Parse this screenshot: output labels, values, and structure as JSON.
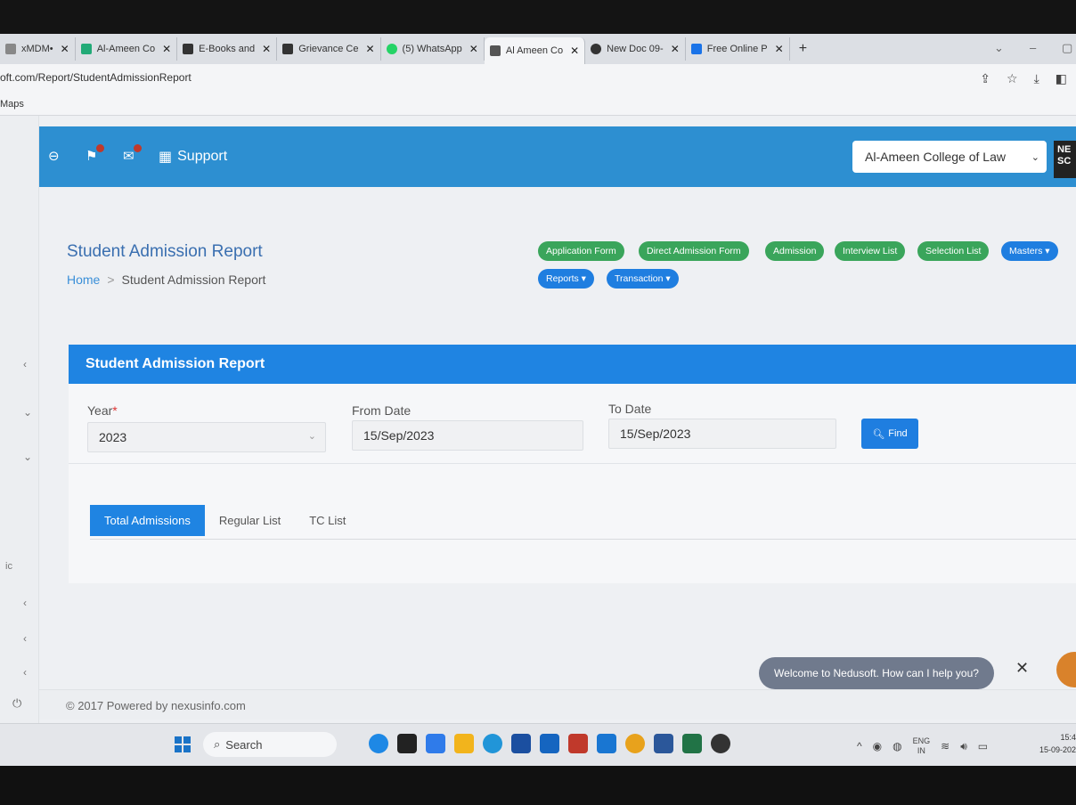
{
  "browser": {
    "tabs": [
      {
        "label": "xMDM•",
        "color": "#888"
      },
      {
        "label": "Al-Ameen Co",
        "color": "#2a7"
      },
      {
        "label": "E-Books and",
        "color": "#333"
      },
      {
        "label": "Grievance Ce",
        "color": "#333"
      },
      {
        "label": "(5) WhatsApp",
        "color": "#25d366"
      },
      {
        "label": "Al Ameen Co",
        "color": "#555",
        "active": true
      },
      {
        "label": "New Doc 09-",
        "color": "#333"
      },
      {
        "label": "Free Online P",
        "color": "#1a73e8"
      }
    ],
    "url": "oft.com/Report/StudentAdmissionReport",
    "bookmark": "Maps"
  },
  "header": {
    "support_label": "Support",
    "college_select": "Al-Ameen College of Law",
    "logo_text": "NE SC"
  },
  "page": {
    "title": "Student Admission Report",
    "breadcrumb": {
      "home": "Home",
      "current": "Student Admission Report"
    }
  },
  "actions": {
    "green": [
      "Application Form",
      "Direct Admission Form",
      "Admission",
      "Interview List",
      "Selection List"
    ],
    "blue": [
      "Masters",
      "Reports",
      "Transaction"
    ]
  },
  "card": {
    "title": "Student Admission Report",
    "year_label": "Year",
    "year_value": "2023",
    "from_label": "From Date",
    "from_value": "15/Sep/2023",
    "to_label": "To Date",
    "to_value": "15/Sep/2023",
    "find_label": "Find"
  },
  "tabs": [
    "Total Admissions",
    "Regular List",
    "TC List"
  ],
  "footer": {
    "text": "© 2017 Powered by nexusinfo.com"
  },
  "chat": {
    "message": "Welcome to Nedusoft. How can I help you?"
  },
  "taskbar": {
    "search": "Search",
    "lang": "ENG",
    "region": "IN",
    "time": "15:4",
    "date": "15-09-202"
  },
  "colors": {
    "brand_blue": "#2d8fd1",
    "green": "#3aa55b",
    "button_blue": "#1f7ee0"
  }
}
